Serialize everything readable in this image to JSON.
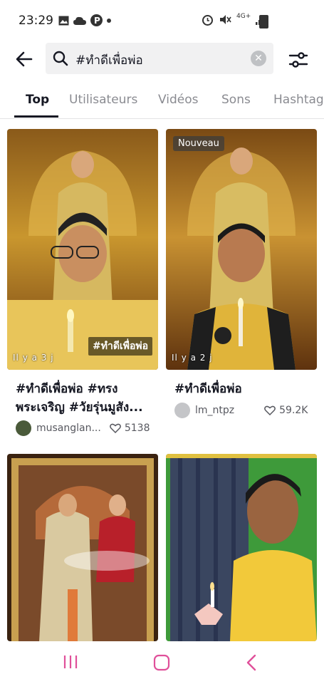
{
  "status_bar": {
    "time": "23:29",
    "network": "4G+"
  },
  "search": {
    "query": "#ทำดีเพื่อพ่อ",
    "clear_symbol": "✕"
  },
  "tabs": [
    {
      "label": "Top",
      "active": true
    },
    {
      "label": "Utilisateurs",
      "active": false
    },
    {
      "label": "Vidéos",
      "active": false
    },
    {
      "label": "Sons",
      "active": false
    },
    {
      "label": "Hashtag",
      "active": false
    }
  ],
  "results": [
    {
      "title": "#ทำดีเพื่อพ่อ #ทรง\nพระเจริญ #วัยรุ่นมูสัง...",
      "ago": "Il y a 3 j",
      "overlay_tag": "#ทำดีเพื่อพ่อ",
      "author": "musanglan...",
      "likes": "5138"
    },
    {
      "badge": "Nouveau",
      "title": "#ทำดีเพื่อพ่อ",
      "ago": "Il y a 2 j",
      "author": "lm_ntpz",
      "likes": "59.2K"
    },
    {},
    {}
  ],
  "colors": {
    "accent_text": "#161823",
    "muted_text": "#8a8b91",
    "search_bg": "#f1f1f2",
    "nav_icon": "#e0509a"
  }
}
